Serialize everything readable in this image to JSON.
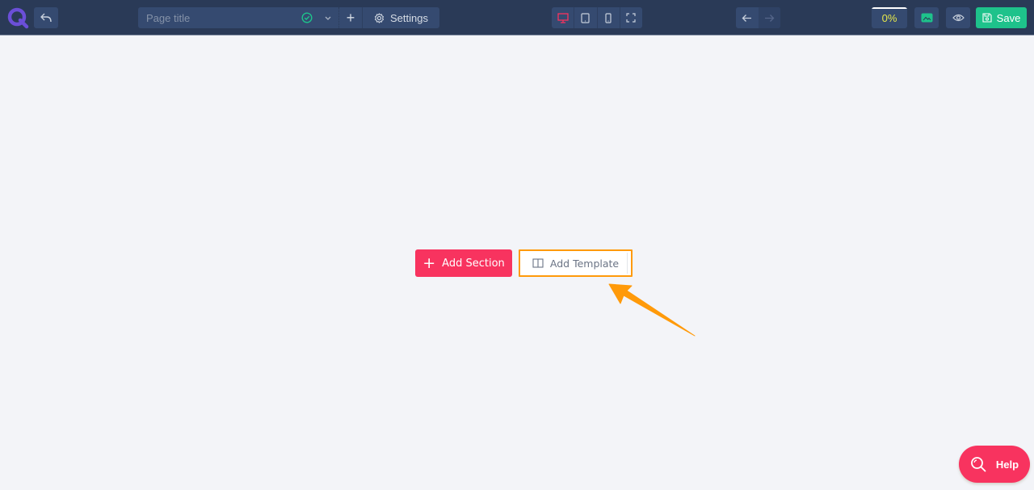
{
  "header": {
    "logo_icon": "q-logo-icon",
    "back_icon": "reply-arrow-icon",
    "page_title": {
      "value": "",
      "placeholder": "Page title",
      "status_icon": "check-circle-icon",
      "dropdown_icon": "chevron-down-icon",
      "add_icon": "plus-icon",
      "add_symbol": "+"
    },
    "settings": {
      "label": "Settings",
      "icon": "gear-icon"
    },
    "devices": [
      {
        "name": "desktop",
        "icon": "desktop-icon",
        "active": true
      },
      {
        "name": "tablet",
        "icon": "tablet-icon",
        "active": false
      },
      {
        "name": "mobile",
        "icon": "mobile-icon",
        "active": false
      },
      {
        "name": "fullscreen",
        "icon": "fullscreen-icon",
        "active": false
      }
    ],
    "history": {
      "undo_icon": "arrow-left-icon",
      "redo_icon": "arrow-right-icon",
      "redo_enabled": false
    },
    "progress": {
      "label": "0%",
      "value": 0
    },
    "media_icon": "image-icon",
    "preview_icon": "eye-icon",
    "save": {
      "label": "Save",
      "icon": "floppy-disk-icon"
    }
  },
  "canvas": {
    "add_section": {
      "label": "Add Section",
      "symbol": "+"
    },
    "add_template": {
      "label": "Add Template",
      "icon": "book-open-icon"
    }
  },
  "annotation": {
    "type": "arrow",
    "color": "#ff9a0a",
    "target": "add-template-button"
  },
  "help": {
    "label": "Help",
    "icon": "search-icon"
  },
  "colors": {
    "header_bg": "#2a3a57",
    "control_bg": "#354a70",
    "accent_pink": "#f8335f",
    "save_green": "#1ec28b",
    "progress_yellow": "#e6e84a",
    "highlight_orange": "#ff9a0a",
    "logo_purple": "#6b4fd8",
    "canvas_bg": "#f3f4f8"
  }
}
